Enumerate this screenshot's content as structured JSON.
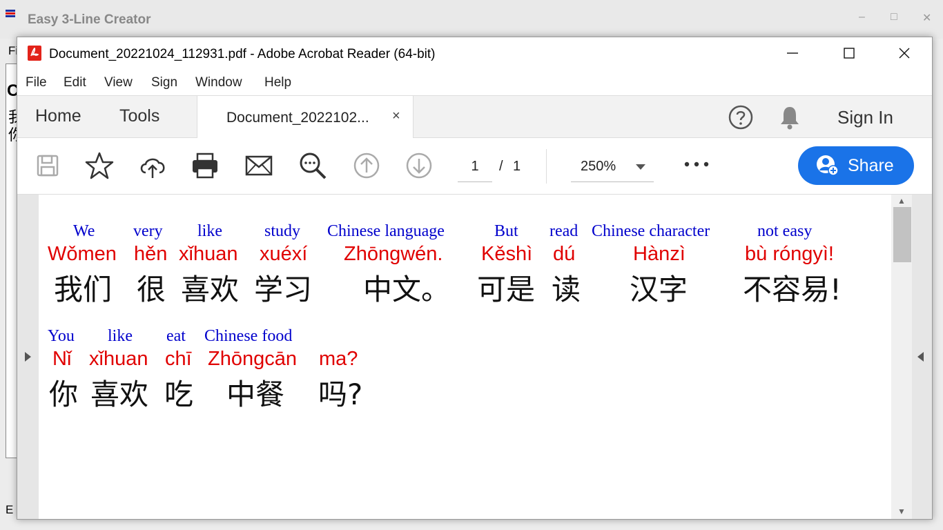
{
  "background_window": {
    "title": "Easy 3-Line Creator",
    "menu_partial": "Fi",
    "glyph_partial_1": "C",
    "glyph_partial_2": "我",
    "glyph_partial_3": "你",
    "status_partial": "E",
    "minimize": "–",
    "maximize": "□",
    "close": "✕"
  },
  "acrobat": {
    "title": "Document_20221024_112931.pdf - Adobe Acrobat Reader (64-bit)",
    "menu": [
      "File",
      "Edit",
      "View",
      "Sign",
      "Window",
      "Help"
    ],
    "tabs": {
      "home": "Home",
      "tools": "Tools",
      "document": "Document_2022102...",
      "close": "×"
    },
    "sign_in": "Sign In",
    "toolbar": {
      "page_current": "1",
      "page_separator": "/",
      "page_total": "1",
      "zoom": "250%",
      "share": "Share"
    },
    "colors": {
      "share_blue": "#1a73e8",
      "pdf_red": "#e2231a",
      "english": "#0000cc",
      "pinyin": "#e00000"
    },
    "icons": [
      "save-icon",
      "bookmark-star-icon",
      "upload-cloud-icon",
      "print-icon",
      "mail-icon",
      "zoom-search-icon",
      "page-up-icon",
      "page-down-icon",
      "more-icon",
      "help-icon",
      "bell-icon",
      "share-user-icon"
    ]
  },
  "document": {
    "line1": {
      "en": [
        "We",
        "very",
        "like",
        "study",
        "Chinese language",
        "But",
        "read",
        "Chinese character",
        "not easy"
      ],
      "py": [
        "Wǒmen",
        "hěn",
        "xǐhuan",
        "xuéxí",
        "Zhōngwén.",
        "Kěshì",
        "dú",
        "Hànzì",
        "bù róngyì!"
      ],
      "zh": [
        "我们",
        "很",
        "喜欢",
        "学习",
        "中文。",
        "可是",
        "读",
        "汉字",
        "不容易!"
      ]
    },
    "line2": {
      "en": [
        "You",
        "like",
        "eat",
        "Chinese food"
      ],
      "py": [
        "Nǐ",
        "xǐhuan",
        "chī",
        "Zhōngcān",
        "ma?"
      ],
      "zh": [
        "你",
        "喜欢",
        "吃",
        "中餐",
        "吗?"
      ]
    }
  }
}
